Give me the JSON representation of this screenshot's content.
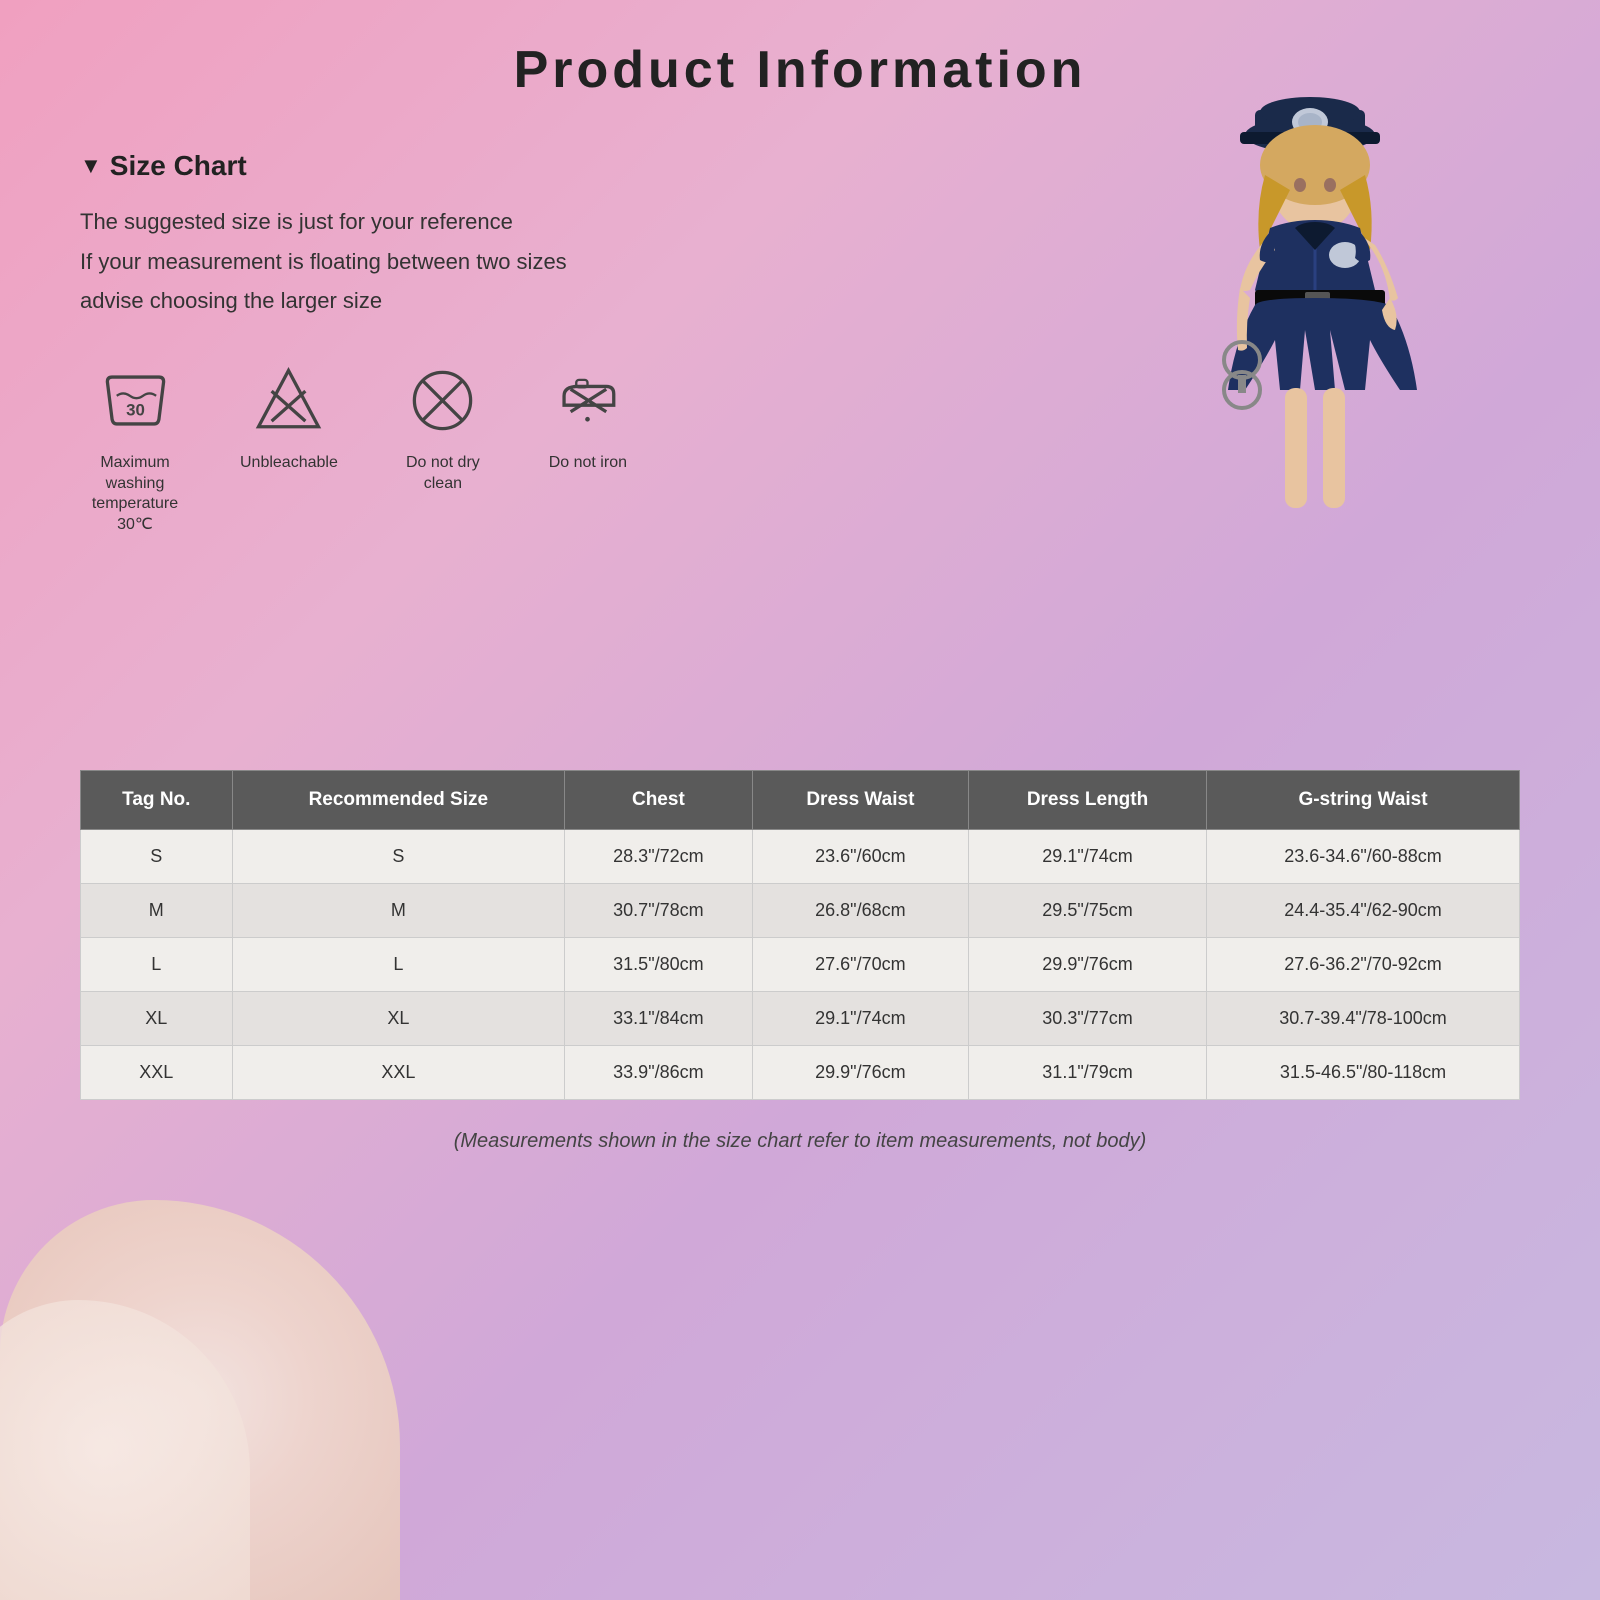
{
  "page": {
    "title": "Product  Information",
    "background": "linear-gradient pink to lavender"
  },
  "size_chart": {
    "title": "Size Chart",
    "description_lines": [
      "The suggested size is just for your reference",
      "If your measurement is floating between two sizes",
      "advise choosing the larger size"
    ]
  },
  "care_instructions": [
    {
      "id": "wash",
      "label": "Maximum washing\ntemperature 30℃",
      "icon": "wash-30"
    },
    {
      "id": "no-bleach",
      "label": "Unbleachable",
      "icon": "no-bleach"
    },
    {
      "id": "no-dry-clean",
      "label": "Do not dry clean",
      "icon": "no-dry-clean"
    },
    {
      "id": "no-iron",
      "label": "Do not iron",
      "icon": "no-iron"
    }
  ],
  "table": {
    "headers": [
      "Tag No.",
      "Recommended Size",
      "Chest",
      "Dress Waist",
      "Dress Length",
      "G-string Waist"
    ],
    "rows": [
      {
        "tag": "S",
        "recommended": "S",
        "chest": "28.3\"/72cm",
        "dress_waist": "23.6\"/60cm",
        "dress_length": "29.1\"/74cm",
        "gstring_waist": "23.6-34.6\"/60-88cm"
      },
      {
        "tag": "M",
        "recommended": "M",
        "chest": "30.7\"/78cm",
        "dress_waist": "26.8\"/68cm",
        "dress_length": "29.5\"/75cm",
        "gstring_waist": "24.4-35.4\"/62-90cm"
      },
      {
        "tag": "L",
        "recommended": "L",
        "chest": "31.5\"/80cm",
        "dress_waist": "27.6\"/70cm",
        "dress_length": "29.9\"/76cm",
        "gstring_waist": "27.6-36.2\"/70-92cm"
      },
      {
        "tag": "XL",
        "recommended": "XL",
        "chest": "33.1\"/84cm",
        "dress_waist": "29.1\"/74cm",
        "dress_length": "30.3\"/77cm",
        "gstring_waist": "30.7-39.4\"/78-100cm"
      },
      {
        "tag": "XXL",
        "recommended": "XXL",
        "chest": "33.9\"/86cm",
        "dress_waist": "29.9\"/76cm",
        "dress_length": "31.1\"/79cm",
        "gstring_waist": "31.5-46.5\"/80-118cm"
      }
    ],
    "note": "(Measurements shown in the size chart refer to item measurements, not body)"
  }
}
